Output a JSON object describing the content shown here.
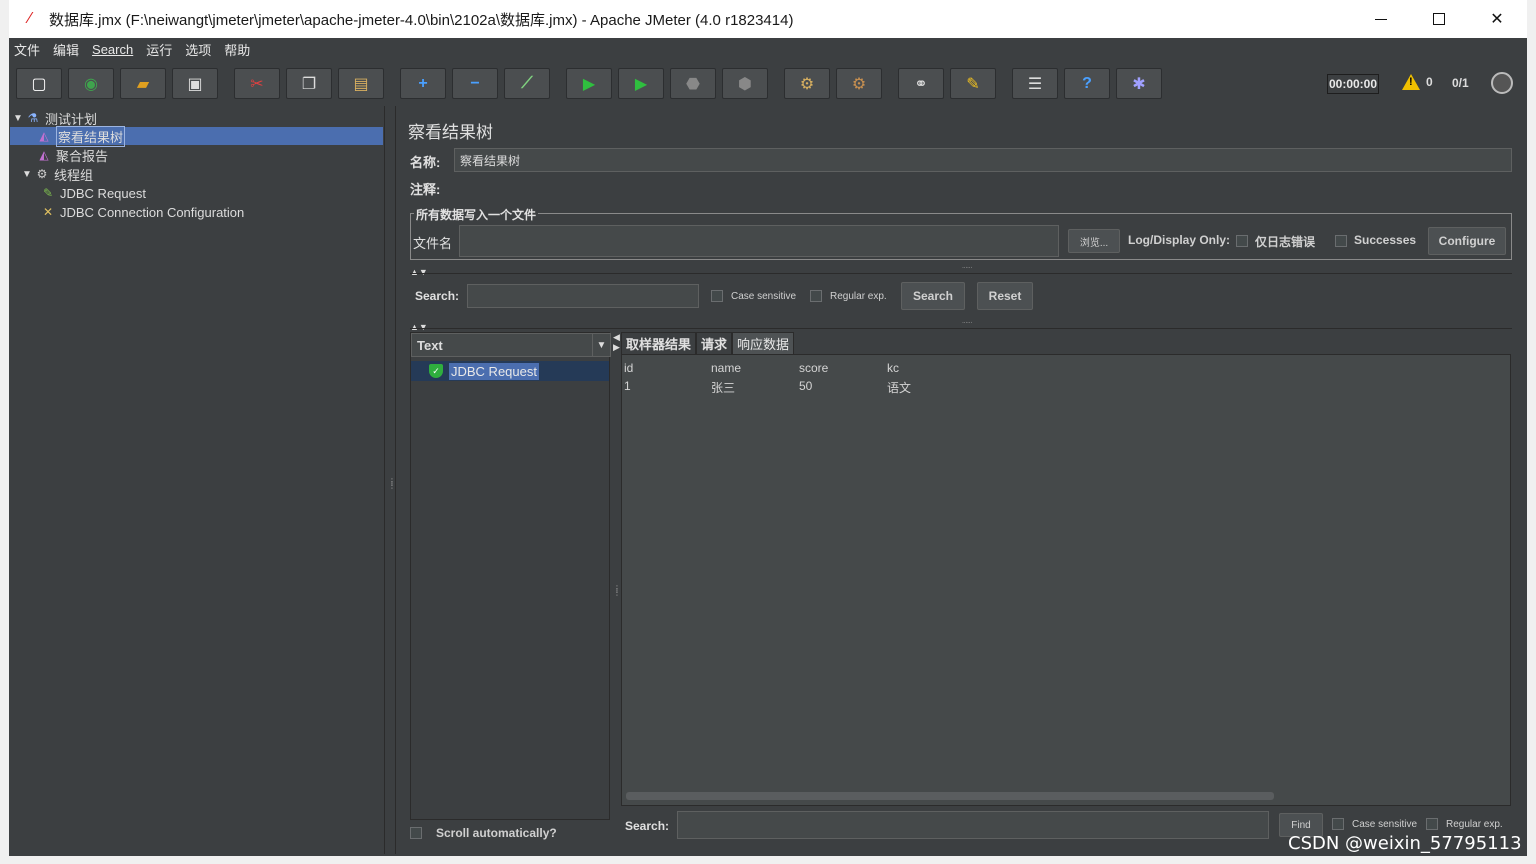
{
  "window": {
    "title": "数据库.jmx (F:\\neiwangt\\jmeter\\jmeter\\apache-jmeter-4.0\\bin\\2102a\\数据库.jmx) - Apache JMeter (4.0 r1823414)",
    "min_icon": "minimize-icon",
    "max_icon": "maximize-icon",
    "close_glyph": "✕"
  },
  "menu": [
    "文件",
    "编辑",
    "Search",
    "运行",
    "选项",
    "帮助"
  ],
  "toolbar": {
    "buttons": [
      {
        "name": "new-icon",
        "glyph": "▢",
        "color": "#ffffff"
      },
      {
        "name": "templates-icon",
        "glyph": "◉",
        "color": "#3fa34d"
      },
      {
        "name": "open-icon",
        "glyph": "▰",
        "color": "#e0a020"
      },
      {
        "name": "save-icon",
        "glyph": "▣",
        "color": "#dddddd"
      },
      {
        "name": "cut-icon",
        "glyph": "✂",
        "color": "#e04040"
      },
      {
        "name": "copy-icon",
        "glyph": "❐",
        "color": "#dddddd"
      },
      {
        "name": "paste-icon",
        "glyph": "▤",
        "color": "#d8b060"
      },
      {
        "name": "expand-icon",
        "glyph": "+",
        "color": "#4aa0ff"
      },
      {
        "name": "collapse-icon",
        "glyph": "−",
        "color": "#4aa0ff"
      },
      {
        "name": "toggle-icon",
        "glyph": "⟋",
        "color": "#7fd07f"
      },
      {
        "name": "start-icon",
        "glyph": "▶",
        "color": "#2fbf3f"
      },
      {
        "name": "start-no-pause-icon",
        "glyph": "▶",
        "color": "#2fbf3f"
      },
      {
        "name": "stop-icon",
        "glyph": "⬣",
        "color": "#888888"
      },
      {
        "name": "shutdown-icon",
        "glyph": "⬢",
        "color": "#888888"
      },
      {
        "name": "clear-icon",
        "glyph": "⚙",
        "color": "#d8b060"
      },
      {
        "name": "clear-all-icon",
        "glyph": "⚙",
        "color": "#c89050"
      },
      {
        "name": "search-icon",
        "glyph": "⚭",
        "color": "#dddddd"
      },
      {
        "name": "reset-search-icon",
        "glyph": "✎",
        "color": "#f0c020"
      },
      {
        "name": "function-helper-icon",
        "glyph": "☰",
        "color": "#dddddd"
      },
      {
        "name": "help-icon",
        "glyph": "?",
        "color": "#4aa0ff"
      },
      {
        "name": "remote-icon",
        "glyph": "✱",
        "color": "#a0a0ff"
      }
    ],
    "timer": "00:00:00",
    "warnings": "0",
    "threads": "0/1"
  },
  "tree": {
    "nodes": [
      {
        "label": "测试计划",
        "icon": "test-plan-icon",
        "glyph": "⚗",
        "depth": 0,
        "arrow": "▼",
        "selected": false
      },
      {
        "label": "察看结果树",
        "icon": "listener-icon",
        "glyph": "◭",
        "depth": 1,
        "arrow": "",
        "selected": true
      },
      {
        "label": "聚合报告",
        "icon": "listener-icon",
        "glyph": "◭",
        "depth": 1,
        "arrow": "",
        "selected": false
      },
      {
        "label": "线程组",
        "icon": "gear-icon",
        "glyph": "⚙",
        "depth": 1,
        "arrow": "▼",
        "selected": false
      },
      {
        "label": "JDBC Request",
        "icon": "sampler-icon",
        "glyph": "✎",
        "depth": 2,
        "arrow": "",
        "selected": false
      },
      {
        "label": "JDBC Connection Configuration",
        "icon": "config-icon",
        "glyph": "✕",
        "depth": 2,
        "arrow": "",
        "selected": false
      }
    ]
  },
  "panel": {
    "title": "察看结果树",
    "name_label": "名称:",
    "name_value": "察看结果树",
    "comment_label": "注释:",
    "comment_value": "",
    "file_group_legend": "所有数据写入一个文件",
    "filename_label": "文件名",
    "filename_value": "",
    "browse_label": "浏览...",
    "log_display_label": "Log/Display Only:",
    "errors_only_label": "仅日志错误",
    "successes_label": "Successes",
    "configure_label": "Configure"
  },
  "search_bar": {
    "label": "Search:",
    "value": "",
    "case_sensitive": "Case sensitive",
    "regular_exp": "Regular exp.",
    "search_button": "Search",
    "reset_button": "Reset"
  },
  "result_list": {
    "renderer": "Text",
    "items": [
      "JDBC Request"
    ],
    "scroll_auto_label": "Scroll automatically?"
  },
  "tabs": [
    "取样器结果",
    "请求",
    "响应数据"
  ],
  "active_tab": 2,
  "response_table": {
    "headers": [
      "id",
      "name",
      "score",
      "kc"
    ],
    "rows": [
      [
        "1",
        "张三",
        "50",
        "语文"
      ]
    ]
  },
  "find_bar": {
    "label": "Search:",
    "value": "",
    "find_button": "Find",
    "case_sensitive": "Case sensitive",
    "regular_exp": "Regular exp."
  },
  "watermark": "CSDN @weixin_57795113"
}
